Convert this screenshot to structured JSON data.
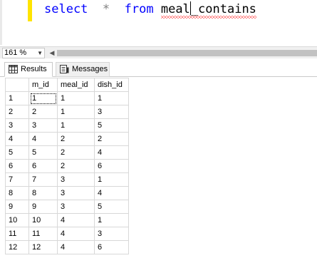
{
  "editor": {
    "tokens": {
      "select": "select",
      "star": "*",
      "from": "from",
      "table_before_caret": "meal",
      "table_after_caret": "_contains"
    }
  },
  "zoom": {
    "value": "161 %"
  },
  "tabs": {
    "results": "Results",
    "messages": "Messages"
  },
  "grid": {
    "columns": [
      "m_id",
      "meal_id",
      "dish_id"
    ],
    "rows": [
      [
        "1",
        "1",
        "1",
        "1"
      ],
      [
        "2",
        "2",
        "1",
        "3"
      ],
      [
        "3",
        "3",
        "1",
        "5"
      ],
      [
        "4",
        "4",
        "2",
        "2"
      ],
      [
        "5",
        "5",
        "2",
        "4"
      ],
      [
        "6",
        "6",
        "2",
        "6"
      ],
      [
        "7",
        "7",
        "3",
        "1"
      ],
      [
        "8",
        "8",
        "3",
        "4"
      ],
      [
        "9",
        "9",
        "3",
        "5"
      ],
      [
        "10",
        "10",
        "4",
        "1"
      ],
      [
        "11",
        "11",
        "4",
        "3"
      ],
      [
        "12",
        "12",
        "4",
        "6"
      ]
    ]
  },
  "colors": {
    "keyword": "#0000ff",
    "operator": "#808080",
    "error_squiggle": "#ff0000",
    "change_bar": "#ffe400"
  }
}
